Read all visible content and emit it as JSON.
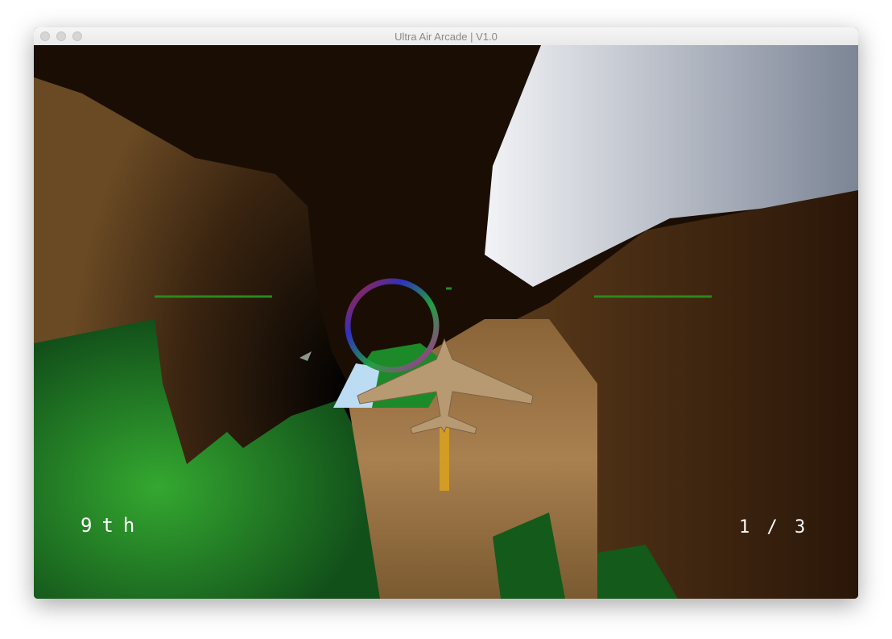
{
  "window": {
    "title": "Ultra Air Arcade | V1.0"
  },
  "hud": {
    "position": "9th",
    "lap": "1 / 3"
  },
  "colors": {
    "rock": "#1a0e04",
    "sand": "#a07a48",
    "grass": "#2a9a2a",
    "sky": "#c8ccd4",
    "hud_line": "#2a8a1a"
  },
  "icons": [
    "close-button",
    "minimize-button",
    "zoom-button",
    "checkpoint-ring",
    "player-plane",
    "opponent-plane"
  ]
}
